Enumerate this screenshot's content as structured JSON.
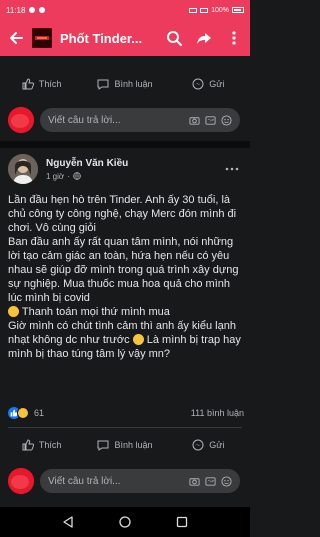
{
  "status_bar": {
    "time": "11:18",
    "battery": "100%"
  },
  "header": {
    "title": "Phốt Tinder..."
  },
  "top_actions": {
    "like": "Thích",
    "comment": "Bình luận",
    "share": "Gửi"
  },
  "top_reply": {
    "placeholder": "Viết câu trả lời..."
  },
  "post": {
    "author": "Nguyễn Văn Kiều",
    "time": "1 giờ",
    "body_lines": [
      "Lần đầu hẹn hò trên Tinder. Anh ấy 30 tuổi, là chủ công ty công nghệ, chạy Merc đón mình đi chơi. Vô cùng giỏi",
      "Ban đầu anh ấy rất quan tâm mình, nói những lời tạo cảm giác an toàn, hứa hẹn nếu có yêu nhau sẽ giúp đỡ mình trong quá trình xây dựng sự nghiệp. Mua thuốc mua hoa quả cho mình lúc mình bị covid",
      "Thanh toán mọi thứ mình mua",
      "Giờ mình có chút tình cảm thì anh ấy kiểu lạnh nhạt không dc như trước",
      "Là mình bị trap hay mình bị thao túng tâm lý vậy mn?"
    ],
    "reactions_count": "61",
    "comments_count": "111 bình luận"
  },
  "bottom_actions": {
    "like": "Thích",
    "comment": "Bình luận",
    "share": "Gửi"
  },
  "bottom_reply": {
    "placeholder": "Viết câu trả lời..."
  },
  "colors": {
    "accent": "#ec3b5d",
    "background": "#18191a",
    "input": "#3a3b3c"
  }
}
